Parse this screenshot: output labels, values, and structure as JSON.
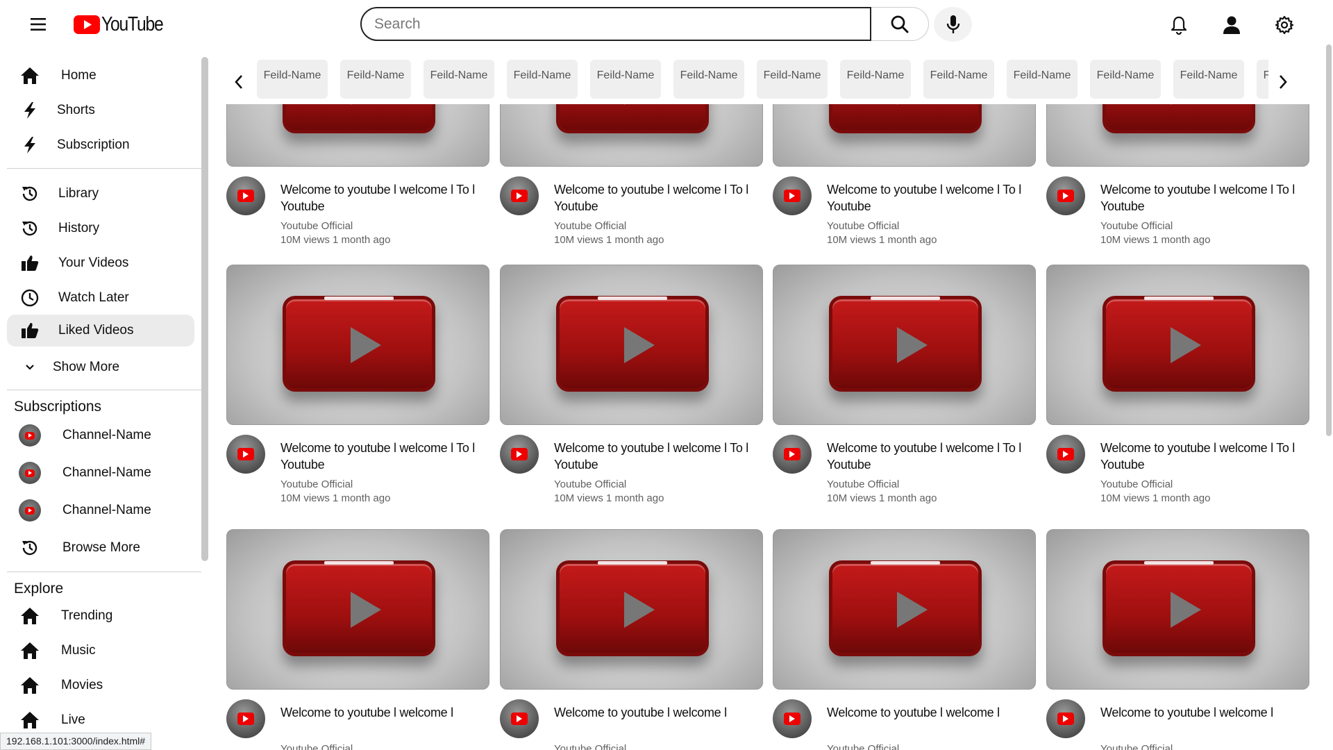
{
  "header": {
    "logo_text": "YouTube",
    "search_placeholder": "Search"
  },
  "sidebar": {
    "main": [
      {
        "label": "Home",
        "icon": "home-icon"
      },
      {
        "label": "Shorts",
        "icon": "bolt-icon"
      },
      {
        "label": "Subscription",
        "icon": "bolt-icon"
      }
    ],
    "library": [
      {
        "label": "Library",
        "icon": "history-icon"
      },
      {
        "label": "History",
        "icon": "history-icon"
      },
      {
        "label": "Your Videos",
        "icon": "thumbs-up-icon"
      },
      {
        "label": "Watch Later",
        "icon": "clock-icon"
      },
      {
        "label": "Liked Videos",
        "icon": "thumbs-up-icon",
        "active": true
      },
      {
        "label": "Show More",
        "icon": "chevron-down-icon"
      }
    ],
    "subscriptions_title": "Subscriptions",
    "subscriptions": [
      {
        "label": "Channel-Name"
      },
      {
        "label": "Channel-Name"
      },
      {
        "label": "Channel-Name"
      }
    ],
    "browse_more": "Browse More",
    "explore_title": "Explore",
    "explore": [
      {
        "label": "Trending",
        "icon": "home-icon"
      },
      {
        "label": "Music",
        "icon": "home-icon"
      },
      {
        "label": "Movies",
        "icon": "home-icon"
      },
      {
        "label": "Live",
        "icon": "home-icon"
      }
    ]
  },
  "chips": [
    "Feild-Name",
    "Feild-Name",
    "Feild-Name",
    "Feild-Name",
    "Feild-Name",
    "Feild-Name",
    "Feild-Name",
    "Feild-Name",
    "Feild-Name",
    "Feild-Name",
    "Feild-Name",
    "Feild-Name",
    "Feild-Name"
  ],
  "video": {
    "title": "Welcome to youtube l welcome l To l Youtube",
    "title_cut": "Welcome to youtube l welcome l",
    "channel": "Youtube Official",
    "meta": "10M views 1 month ago"
  },
  "status_url": "192.168.1.101:3000/index.html#",
  "colors": {
    "brand_red": "#ff0000",
    "active_bg": "#ebebeb"
  }
}
